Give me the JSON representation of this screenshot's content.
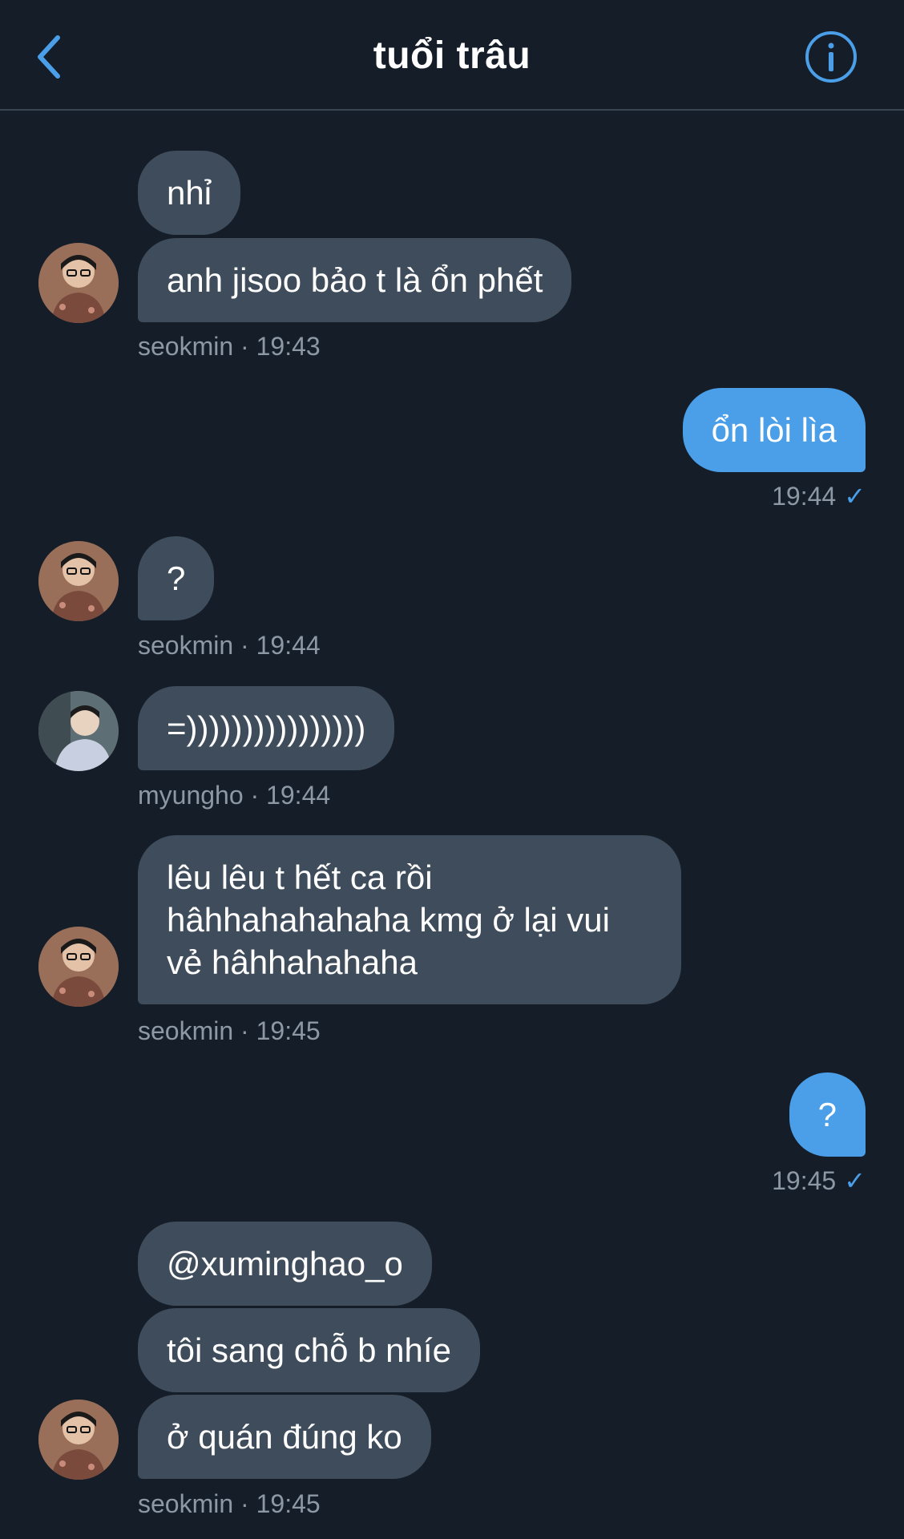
{
  "header": {
    "title": "tuổi trâu"
  },
  "messages": [
    {
      "id": "m1",
      "direction": "in",
      "text": "nhỉ"
    },
    {
      "id": "m2",
      "direction": "in",
      "text": "anh jisoo bảo t là ổn phết"
    },
    {
      "id": "meta1",
      "sender": "seokmin",
      "time": "19:43",
      "label": "seokmin · 19:43"
    },
    {
      "id": "m3",
      "direction": "out",
      "text": "ổn lòi lìa"
    },
    {
      "id": "meta2",
      "time": "19:44"
    },
    {
      "id": "m4",
      "direction": "in",
      "text": "?"
    },
    {
      "id": "meta3",
      "label": "seokmin · 19:44"
    },
    {
      "id": "m5",
      "direction": "in",
      "text": "=))))))))))))))))"
    },
    {
      "id": "meta4",
      "label": "myungho · 19:44"
    },
    {
      "id": "m6",
      "direction": "in",
      "lines": [
        "lêu lêu t hết ca rồi",
        "hâhhahahahaha kmg ở lại vui",
        "vẻ hâhhahahaha"
      ]
    },
    {
      "id": "meta5",
      "label": "seokmin · 19:45"
    },
    {
      "id": "m7",
      "direction": "out",
      "text": "?"
    },
    {
      "id": "meta6",
      "time": "19:45"
    },
    {
      "id": "m8",
      "direction": "in",
      "text": "@xuminghao_o"
    },
    {
      "id": "m9",
      "direction": "in",
      "text": "tôi sang chỗ b nhíe"
    },
    {
      "id": "m10",
      "direction": "in",
      "text": "ở quán đúng ko"
    },
    {
      "id": "meta7",
      "label": "seokmin · 19:45"
    }
  ],
  "colors": {
    "background": "#151d28",
    "incoming_bubble": "#3e4c5b",
    "outgoing_bubble": "#4a9fe8",
    "accent": "#4a9fe8",
    "meta_text": "#8d98a5"
  },
  "icons": {
    "back": "chevron-left-icon",
    "info": "info-circle-icon",
    "read": "checkmark-icon"
  }
}
